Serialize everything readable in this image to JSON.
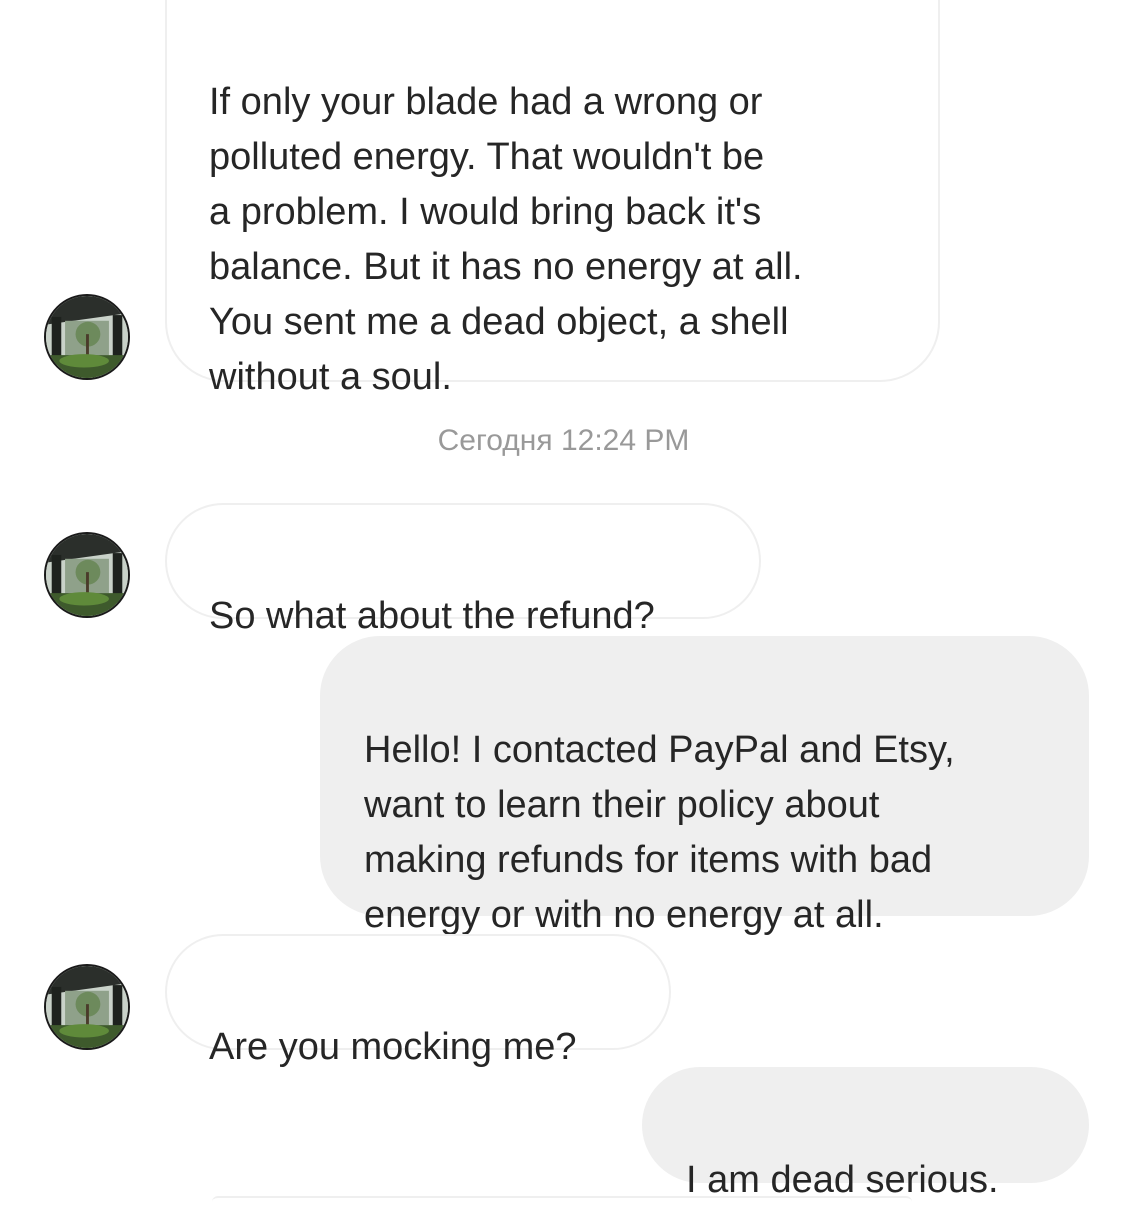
{
  "conversation": {
    "messages": [
      {
        "direction": "incoming",
        "text": "If only your blade had a wrong or\npolluted energy. That wouldn't be\na problem. I would bring back it's\nbalance. But it has no energy at all.\nYou sent me a dead object, a shell\nwithout a soul."
      },
      {
        "direction": "incoming",
        "text": "So what about the refund?"
      },
      {
        "direction": "outgoing",
        "text": "Hello! I contacted PayPal and Etsy,\nwant to learn their policy about\nmaking refunds for items with bad\nenergy or with no energy at all."
      },
      {
        "direction": "incoming",
        "text": "Are you mocking me?"
      },
      {
        "direction": "outgoing",
        "text": "I am dead serious."
      }
    ],
    "timestamp": "Сегодня 12:24 PM"
  },
  "avatar": {
    "icon": "courtyard-garden-photo"
  },
  "colors": {
    "incoming_bubble": "#ffffff",
    "incoming_border": "#efefef",
    "outgoing_bubble": "#efefef",
    "text": "#262626",
    "timestamp": "#999999"
  }
}
